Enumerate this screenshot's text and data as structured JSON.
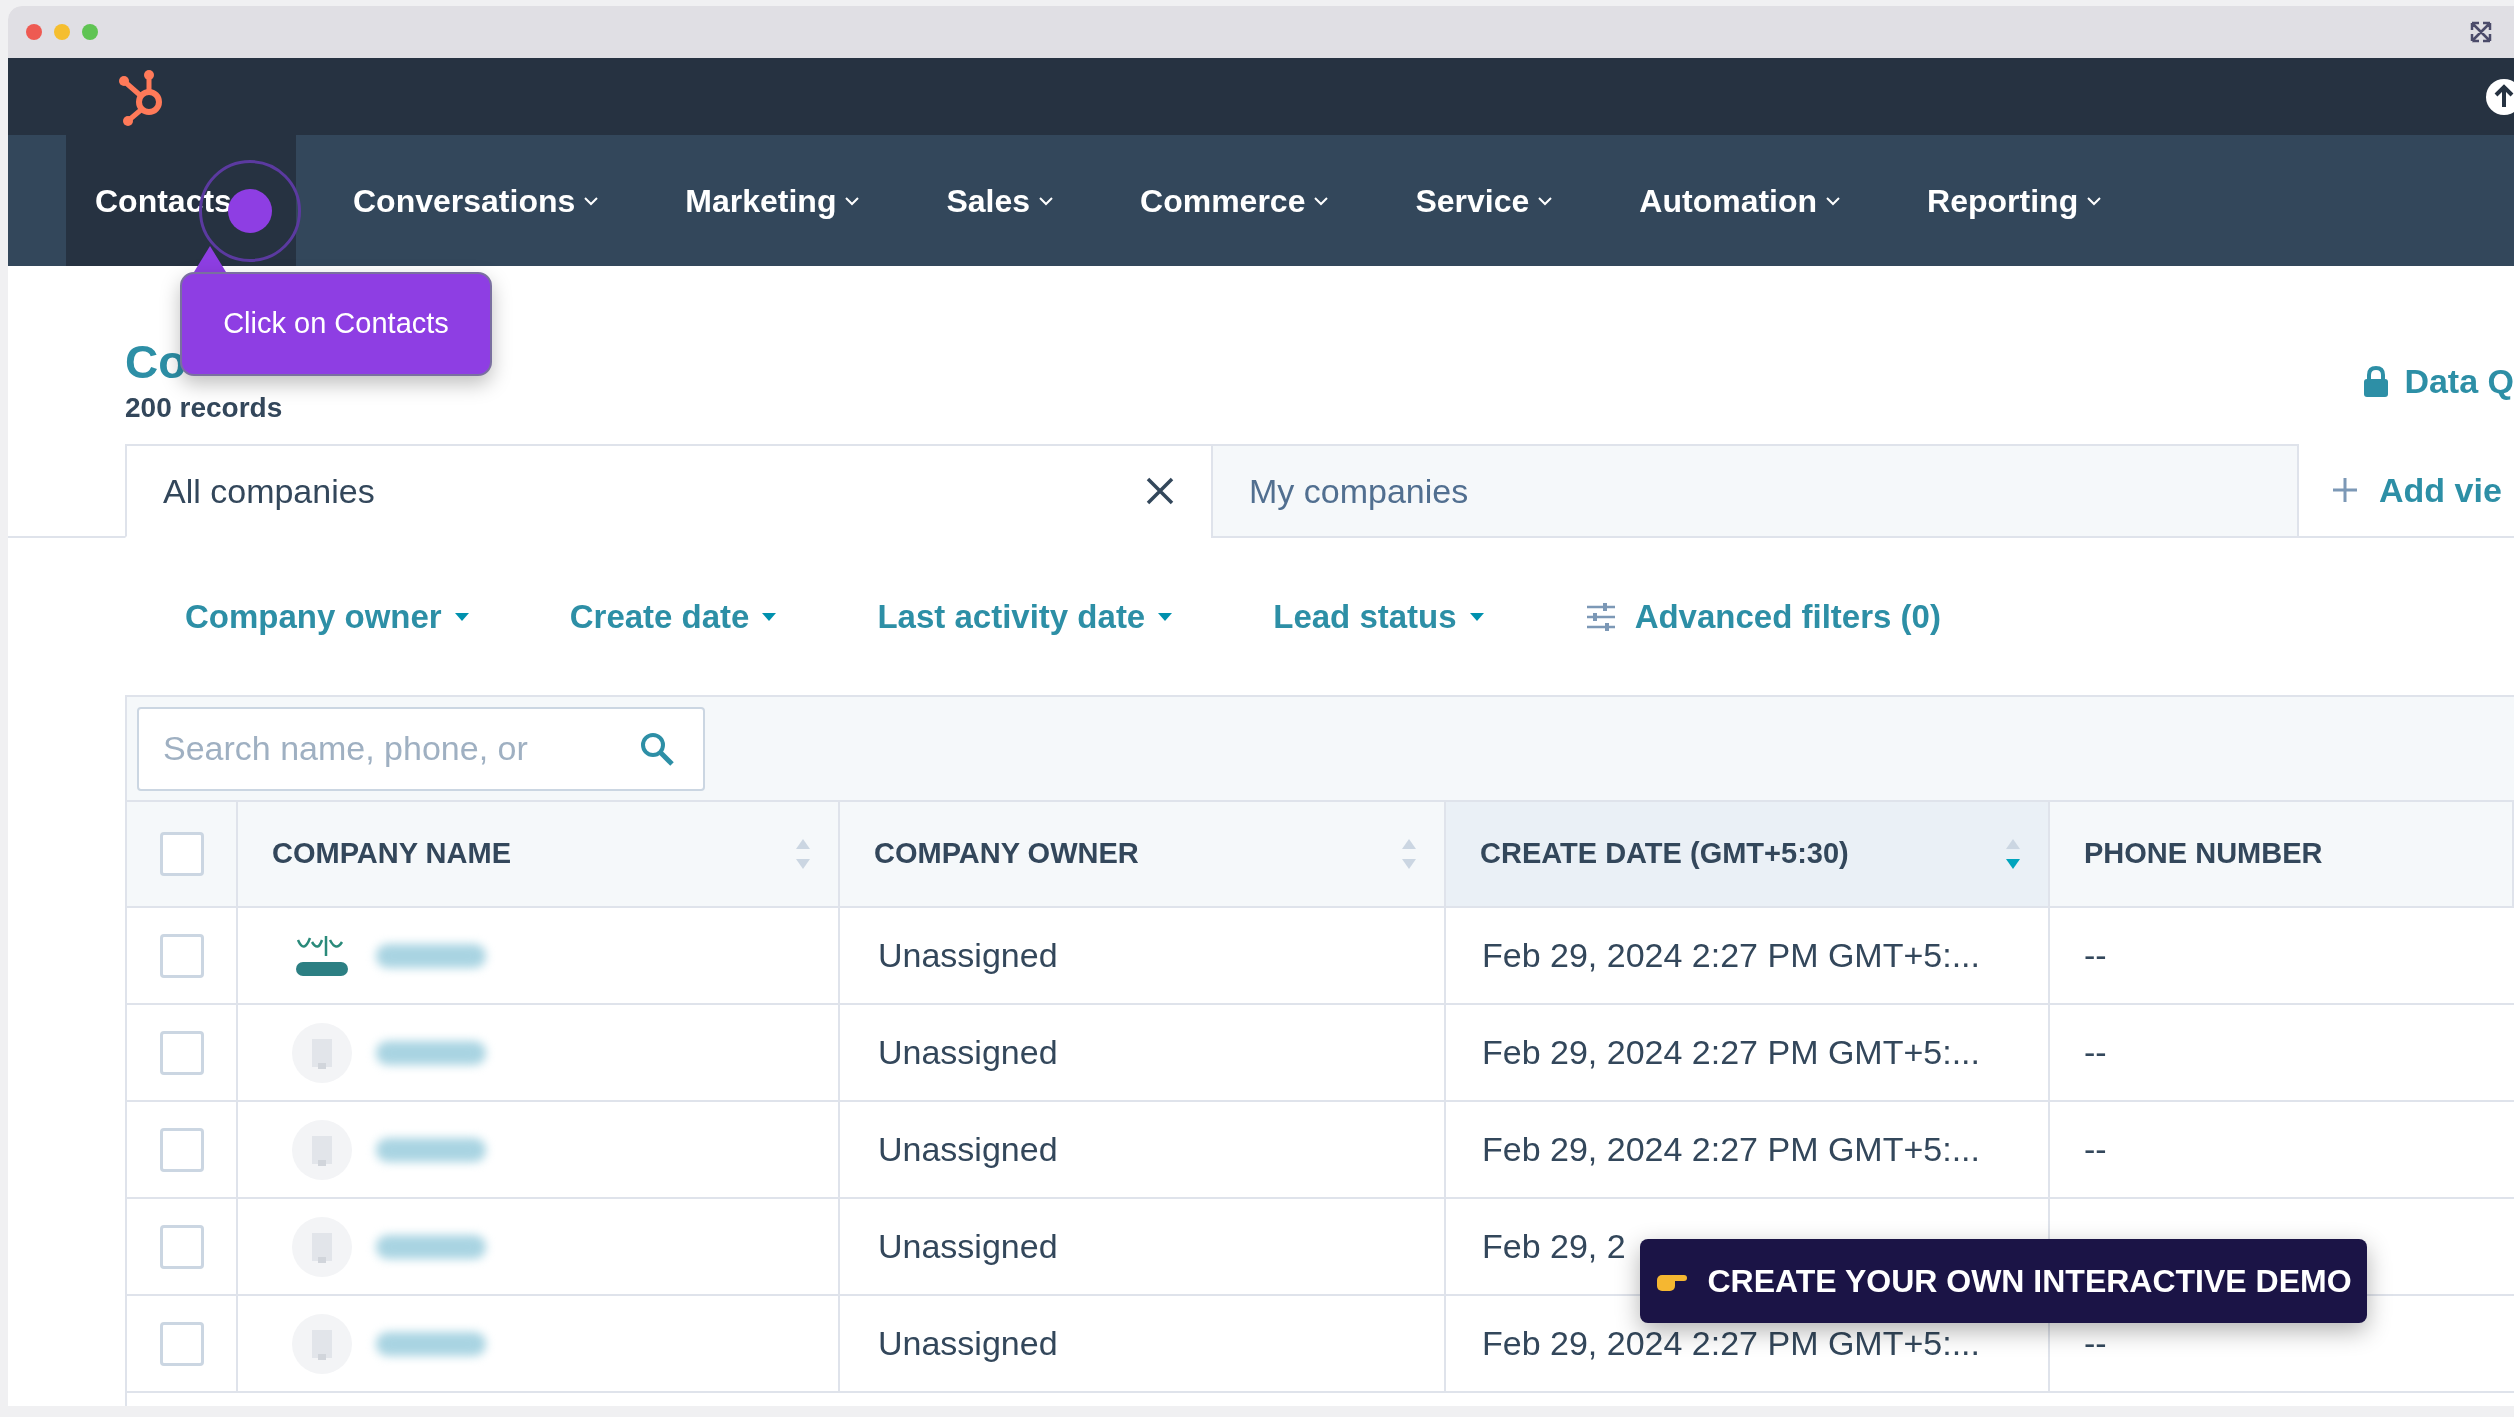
{
  "nav": {
    "items": [
      {
        "label": "Contacts",
        "selected": true,
        "dropdown": false
      },
      {
        "label": "Conversations",
        "selected": false,
        "dropdown": true
      },
      {
        "label": "Marketing",
        "selected": false,
        "dropdown": true
      },
      {
        "label": "Sales",
        "selected": false,
        "dropdown": true
      },
      {
        "label": "Commerce",
        "selected": false,
        "dropdown": true
      },
      {
        "label": "Service",
        "selected": false,
        "dropdown": true
      },
      {
        "label": "Automation",
        "selected": false,
        "dropdown": true
      },
      {
        "label": "Reporting",
        "selected": false,
        "dropdown": true
      }
    ]
  },
  "tour_tooltip": {
    "text": "Click on Contacts"
  },
  "page": {
    "title": "Co",
    "record_count": "200 records",
    "data_quality": "Data Q"
  },
  "view_tabs": [
    {
      "label": "All companies",
      "selected": true,
      "closable": true
    },
    {
      "label": "My companies",
      "selected": false,
      "closable": false
    }
  ],
  "add_view": "Add vie",
  "filters": [
    {
      "label": "Company owner",
      "kind": "dropdown"
    },
    {
      "label": "Create date",
      "kind": "dropdown"
    },
    {
      "label": "Last activity date",
      "kind": "dropdown"
    },
    {
      "label": "Lead status",
      "kind": "dropdown"
    },
    {
      "label": "Advanced filters (0)",
      "kind": "advanced"
    }
  ],
  "search": {
    "placeholder": "Search name, phone, or"
  },
  "table": {
    "header_checked": false,
    "columns": [
      {
        "label": "COMPANY NAME",
        "sortable": true,
        "selected": false
      },
      {
        "label": "COMPANY OWNER",
        "sortable": true,
        "selected": false
      },
      {
        "label": "CREATE DATE (GMT+5:30)",
        "sortable": true,
        "selected": true
      },
      {
        "label": "PHONE NUMBER",
        "sortable": false,
        "selected": false
      }
    ],
    "rows": [
      {
        "checked": false,
        "kind": "branded",
        "owner": "Unassigned",
        "create_date": "Feb 29, 2024 2:27 PM GMT+5:...",
        "phone": "--"
      },
      {
        "checked": false,
        "kind": "generic",
        "owner": "Unassigned",
        "create_date": "Feb 29, 2024 2:27 PM GMT+5:...",
        "phone": "--"
      },
      {
        "checked": false,
        "kind": "generic",
        "owner": "Unassigned",
        "create_date": "Feb 29, 2024 2:27 PM GMT+5:...",
        "phone": "--"
      },
      {
        "checked": false,
        "kind": "generic",
        "owner": "Unassigned",
        "create_date": "Feb 29, 2"
      },
      {
        "checked": false,
        "kind": "generic",
        "owner": "Unassigned",
        "create_date": "Feb 29, 2024 2:27 PM GMT+5:...",
        "phone": "--"
      }
    ]
  },
  "demo_banner": {
    "text": "CREATE YOUR OWN INTERACTIVE DEMO"
  }
}
